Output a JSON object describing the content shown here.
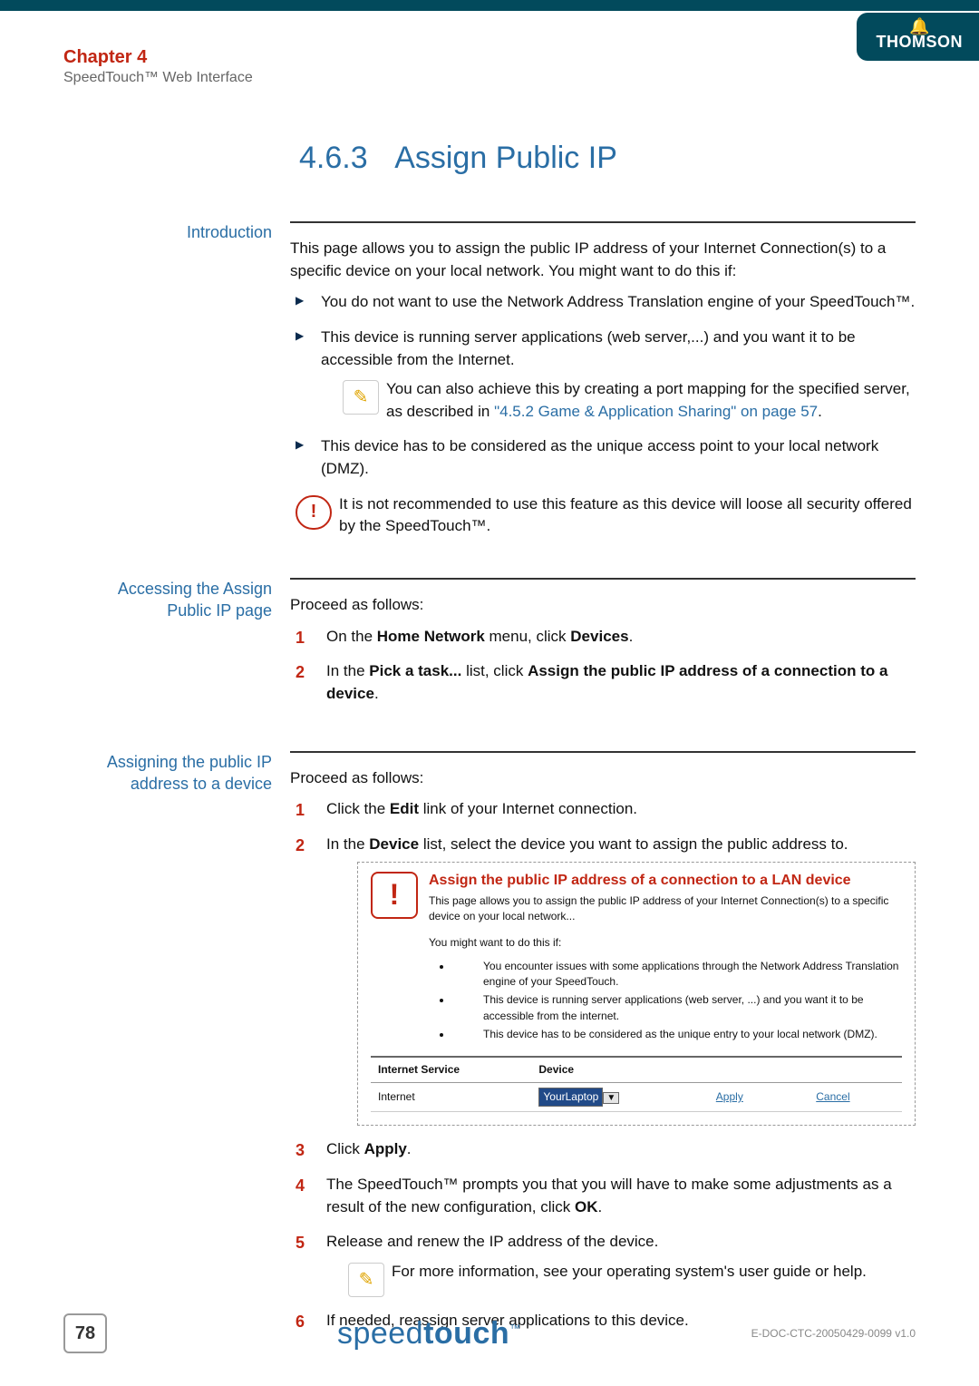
{
  "header": {
    "chapter": "Chapter 4",
    "subtitle": "SpeedTouch™ Web Interface",
    "brand": "THOMSON"
  },
  "title": {
    "prefix": "4.6.3",
    "text": "Assign Public IP"
  },
  "intro": {
    "label": "Introduction",
    "lead": "This page allows you to assign the public IP address of your Internet Connection(s) to a specific device on your local network. You might want to do this if:",
    "b1": "You do not want to use the Network Address Translation engine of your SpeedTouch™.",
    "b2": "This device is running server applications (web server,...) and you want it to be accessible from the Internet.",
    "tip_pre": "You can also achieve this by creating a port mapping for the specified server, as described in ",
    "tip_link": "\"4.5.2 Game & Application Sharing\" on page 57",
    "tip_post": ".",
    "b3": "This device has to be considered as the unique access point to your local network (DMZ).",
    "warn": "It is not recommended to use this feature as this device will loose all security offered by the SpeedTouch™."
  },
  "access": {
    "label1": "Accessing the Assign",
    "label2": "Public IP page",
    "lead": "Proceed as follows:",
    "s1_pre": "On the ",
    "s1_b1": "Home Network",
    "s1_mid": " menu, click ",
    "s1_b2": "Devices",
    "s1_post": ".",
    "s2_pre": "In the ",
    "s2_b1": "Pick a task...",
    "s2_mid": " list, click ",
    "s2_b2": "Assign the public IP address of a connection to a device",
    "s2_post": "."
  },
  "assign": {
    "label1": "Assigning the public IP",
    "label2": "address to a device",
    "lead": "Proceed as follows:",
    "s1_pre": "Click the ",
    "s1_b1": "Edit",
    "s1_post": " link of your Internet connection.",
    "s2_pre": "In the ",
    "s2_b1": "Device",
    "s2_post": " list, select the device you want to assign the public address to.",
    "s3_pre": "Click ",
    "s3_b1": "Apply",
    "s3_post": ".",
    "s4_pre": "The SpeedTouch™ prompts you that you will have to make some adjustments as a result of the new configuration, click ",
    "s4_b1": "OK",
    "s4_post": ".",
    "s5": "Release and renew the IP address of the device.",
    "tip": "For more information, see your operating system's user guide or help.",
    "s6": "If needed, reassign server applications to this device."
  },
  "shot": {
    "title": "Assign the public IP address of a connection to a LAN device",
    "desc": "This page allows you to assign the public IP address of your Internet Connection(s) to a specific device on your local network...",
    "why": "You might want to do this if:",
    "u1": "You encounter issues with some applications through the Network Address Translation engine of your SpeedTouch.",
    "u2": "This device is running server applications (web server, ...) and you want it to be accessible from the internet.",
    "u3": "This device has to be considered as the unique entry to your local network (DMZ).",
    "th1": "Internet Service",
    "th2": "Device",
    "row_service": "Internet",
    "row_device": "YourLaptop",
    "apply": "Apply",
    "cancel": "Cancel"
  },
  "footer": {
    "page": "78",
    "brand_light": "speed",
    "brand_bold": "touch",
    "docid": "E-DOC-CTC-20050429-0099 v1.0"
  }
}
